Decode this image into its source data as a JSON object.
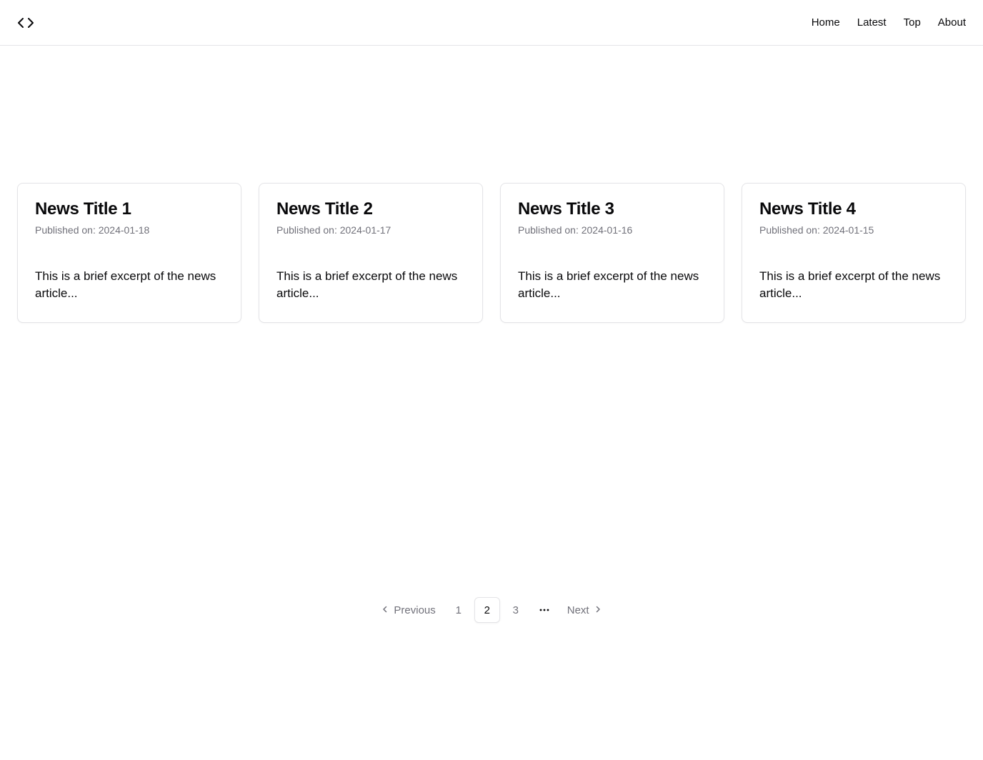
{
  "header": {
    "logo_icon": "code-brackets-icon",
    "nav": [
      {
        "label": "Home"
      },
      {
        "label": "Latest"
      },
      {
        "label": "Top"
      },
      {
        "label": "About"
      }
    ]
  },
  "articles": [
    {
      "title": "News Title 1",
      "date": "Published on: 2024-01-18",
      "excerpt": "This is a brief excerpt of the news article..."
    },
    {
      "title": "News Title 2",
      "date": "Published on: 2024-01-17",
      "excerpt": "This is a brief excerpt of the news article..."
    },
    {
      "title": "News Title 3",
      "date": "Published on: 2024-01-16",
      "excerpt": "This is a brief excerpt of the news article..."
    },
    {
      "title": "News Title 4",
      "date": "Published on: 2024-01-15",
      "excerpt": "This is a brief excerpt of the news article..."
    }
  ],
  "pagination": {
    "previous_label": "Previous",
    "next_label": "Next",
    "pages": [
      "1",
      "2",
      "3"
    ],
    "current_page": "2",
    "ellipsis_icon": "more-horizontal-icon"
  },
  "colors": {
    "text": "#09090b",
    "muted": "#71717a",
    "border": "#e4e4e7"
  }
}
